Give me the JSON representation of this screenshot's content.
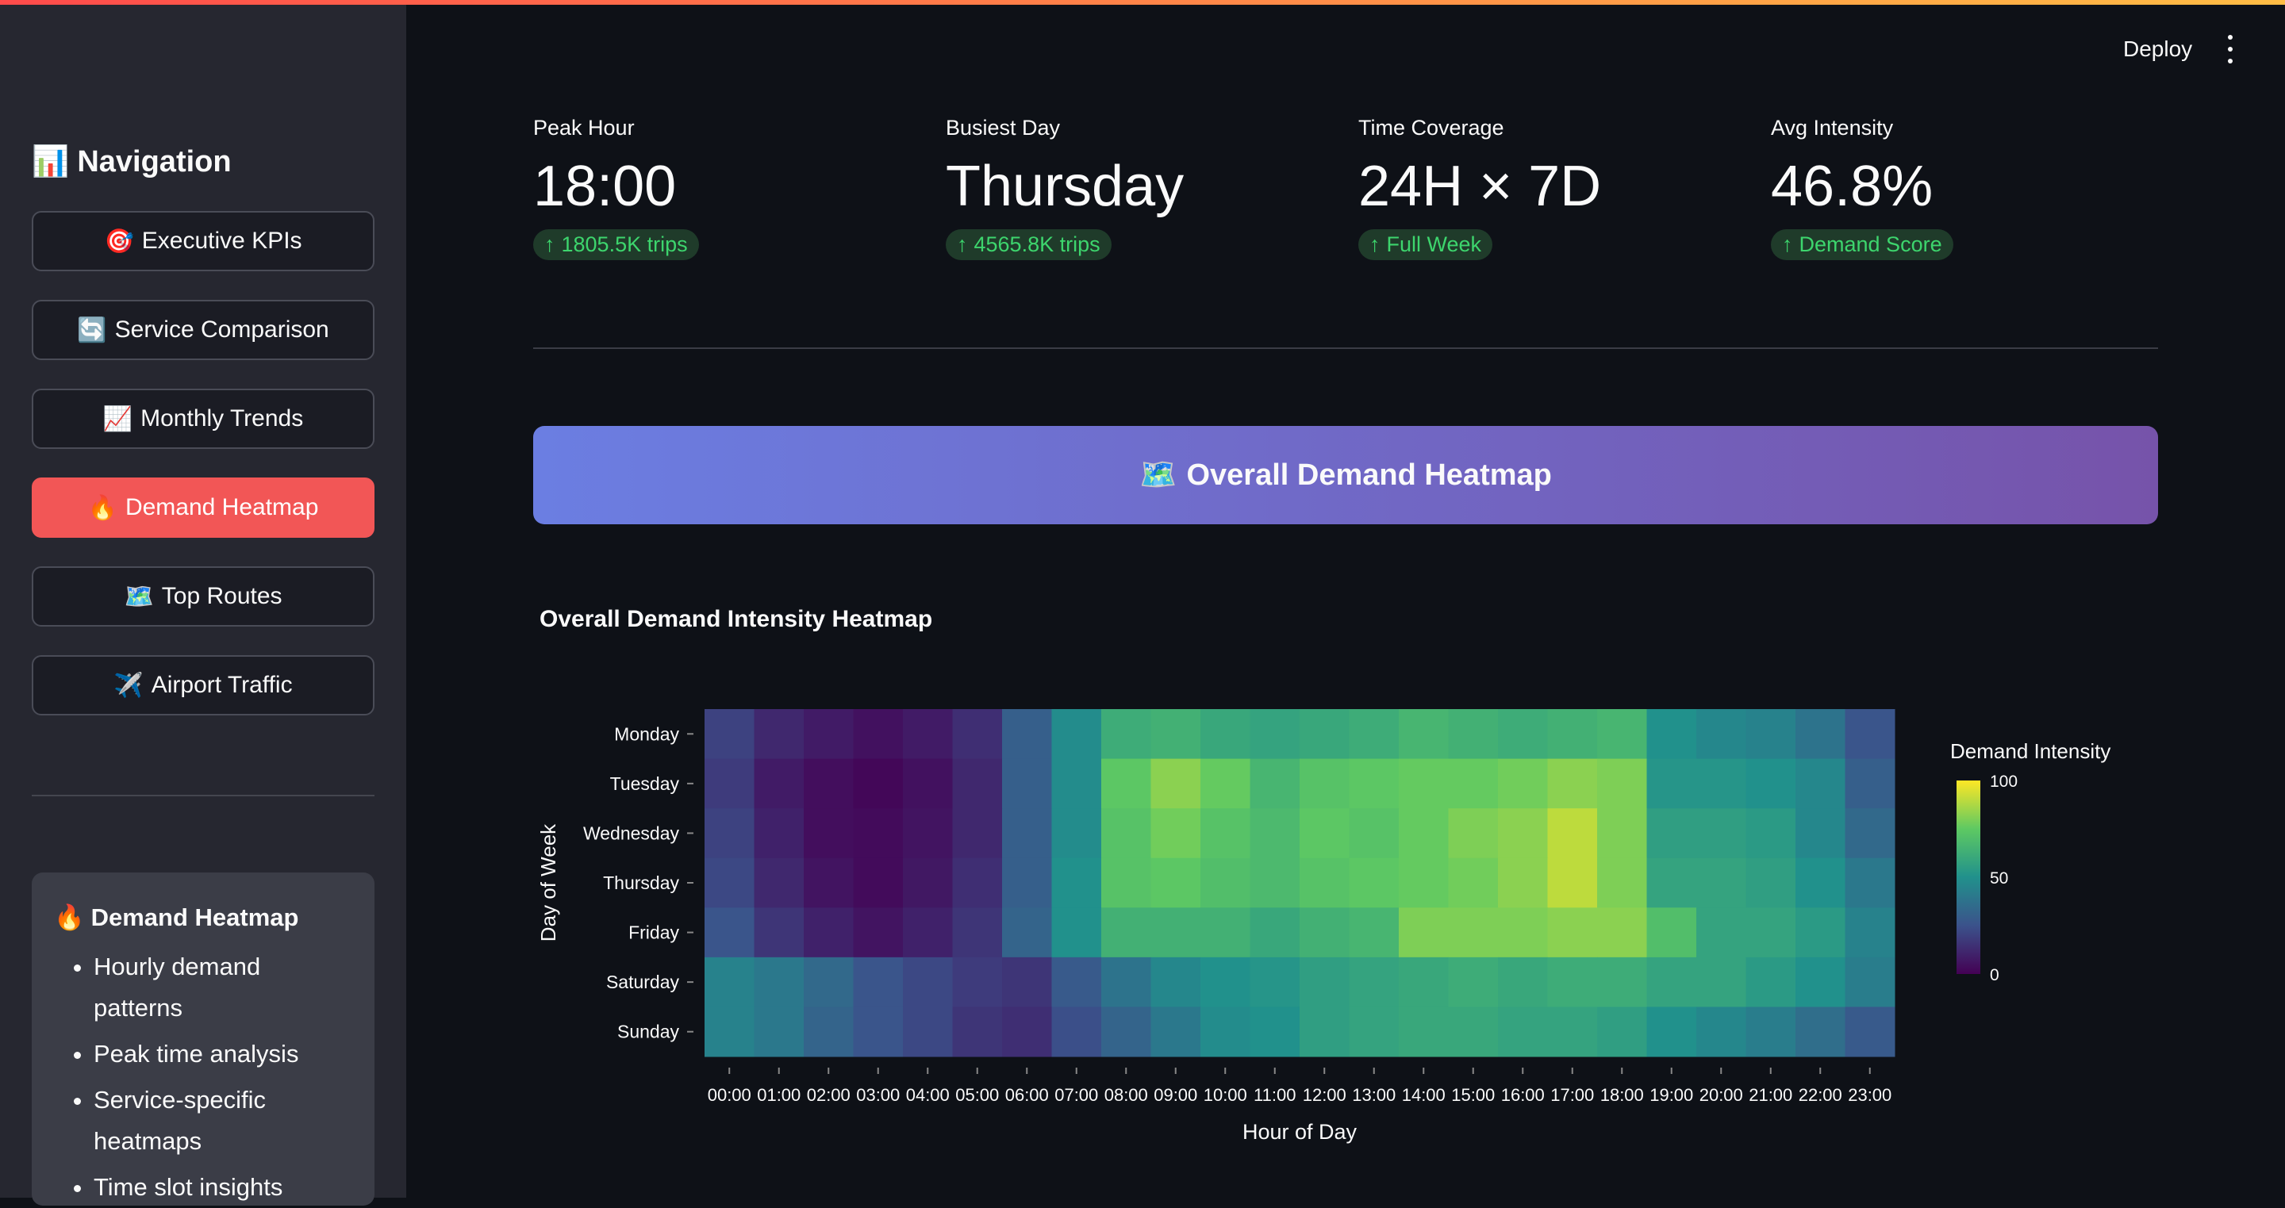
{
  "sidebar": {
    "title": "Navigation",
    "title_icon": "📊",
    "items": [
      {
        "icon": "🎯",
        "label": "Executive KPIs"
      },
      {
        "icon": "🔄",
        "label": "Service Comparison"
      },
      {
        "icon": "📈",
        "label": "Monthly Trends"
      },
      {
        "icon": "🔥",
        "label": "Demand Heatmap",
        "active": true
      },
      {
        "icon": "🗺️",
        "label": "Top Routes"
      },
      {
        "icon": "✈️",
        "label": "Airport Traffic"
      }
    ],
    "info": {
      "icon": "🔥",
      "title": "Demand Heatmap",
      "bullets": [
        "Hourly demand patterns",
        "Peak time analysis",
        "Service-specific heatmaps",
        "Time slot insights"
      ]
    }
  },
  "header": {
    "deploy_label": "Deploy"
  },
  "metrics": [
    {
      "label": "Peak Hour",
      "value": "18:00",
      "delta": "1805.5K trips"
    },
    {
      "label": "Busiest Day",
      "value": "Thursday",
      "delta": "4565.8K trips"
    },
    {
      "label": "Time Coverage",
      "value": "24H × 7D",
      "delta": "Full Week"
    },
    {
      "label": "Avg Intensity",
      "value": "46.8%",
      "delta": "Demand Score"
    }
  ],
  "banner": {
    "icon": "🗺️",
    "title": "Overall Demand Heatmap"
  },
  "colors": {
    "accent": "#f25656",
    "delta_text": "#3dd56d",
    "delta_bg": "#1f3b2a",
    "banner_start": "#6b7ee2",
    "banner_end": "#7653aa"
  },
  "chart_data": {
    "type": "heatmap",
    "title": "Overall Demand Intensity Heatmap",
    "xlabel": "Hour of Day",
    "ylabel": "Day of Week",
    "x": [
      "00:00",
      "01:00",
      "02:00",
      "03:00",
      "04:00",
      "05:00",
      "06:00",
      "07:00",
      "08:00",
      "09:00",
      "10:00",
      "11:00",
      "12:00",
      "13:00",
      "14:00",
      "15:00",
      "16:00",
      "17:00",
      "18:00",
      "19:00",
      "20:00",
      "21:00",
      "22:00",
      "23:00"
    ],
    "y": [
      "Monday",
      "Tuesday",
      "Wednesday",
      "Thursday",
      "Friday",
      "Saturday",
      "Sunday"
    ],
    "colorbar": {
      "title": "Demand Intensity",
      "min": 0,
      "max": 100,
      "ticks": [
        0,
        50,
        100
      ]
    },
    "values": [
      [
        20,
        12,
        8,
        5,
        8,
        14,
        30,
        48,
        62,
        64,
        60,
        58,
        60,
        62,
        66,
        64,
        62,
        64,
        66,
        50,
        46,
        44,
        38,
        26
      ],
      [
        18,
        8,
        4,
        2,
        5,
        12,
        30,
        48,
        74,
        82,
        76,
        66,
        72,
        74,
        76,
        76,
        78,
        82,
        80,
        52,
        52,
        50,
        46,
        30
      ],
      [
        20,
        10,
        4,
        3,
        6,
        12,
        30,
        48,
        72,
        78,
        72,
        68,
        74,
        72,
        76,
        80,
        82,
        90,
        80,
        56,
        56,
        54,
        46,
        34
      ],
      [
        22,
        12,
        6,
        3,
        7,
        14,
        30,
        50,
        72,
        74,
        70,
        68,
        72,
        74,
        76,
        78,
        82,
        90,
        80,
        58,
        58,
        56,
        50,
        40
      ],
      [
        26,
        16,
        10,
        6,
        10,
        16,
        32,
        50,
        64,
        64,
        64,
        60,
        64,
        66,
        80,
        80,
        80,
        82,
        82,
        70,
        58,
        58,
        54,
        44
      ],
      [
        44,
        40,
        34,
        26,
        22,
        18,
        16,
        28,
        38,
        46,
        50,
        52,
        56,
        58,
        60,
        62,
        60,
        62,
        62,
        58,
        58,
        54,
        50,
        42
      ],
      [
        44,
        40,
        32,
        26,
        22,
        16,
        14,
        24,
        32,
        40,
        48,
        50,
        56,
        58,
        60,
        60,
        58,
        58,
        56,
        50,
        46,
        42,
        36,
        28
      ]
    ]
  }
}
